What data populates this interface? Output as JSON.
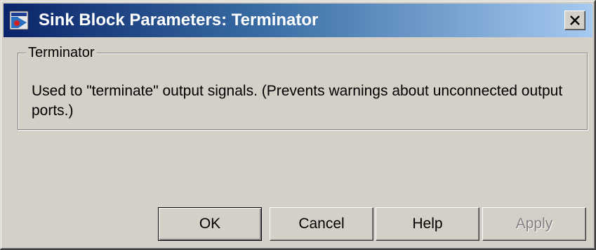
{
  "window": {
    "title": "Sink Block Parameters: Terminator",
    "app_icon": "simulink-block-icon",
    "close_icon": "close-icon"
  },
  "group": {
    "label": "Terminator",
    "description": "Used to \"terminate\" output signals.  (Prevents warnings about unconnected output ports.)"
  },
  "buttons": {
    "ok": "OK",
    "cancel": "Cancel",
    "help": "Help",
    "apply": "Apply"
  },
  "colors": {
    "titlebar_start": "#0a246a",
    "titlebar_end": "#a6caf0",
    "dialog_face": "#d4d0c8",
    "disabled_text": "#808080"
  }
}
